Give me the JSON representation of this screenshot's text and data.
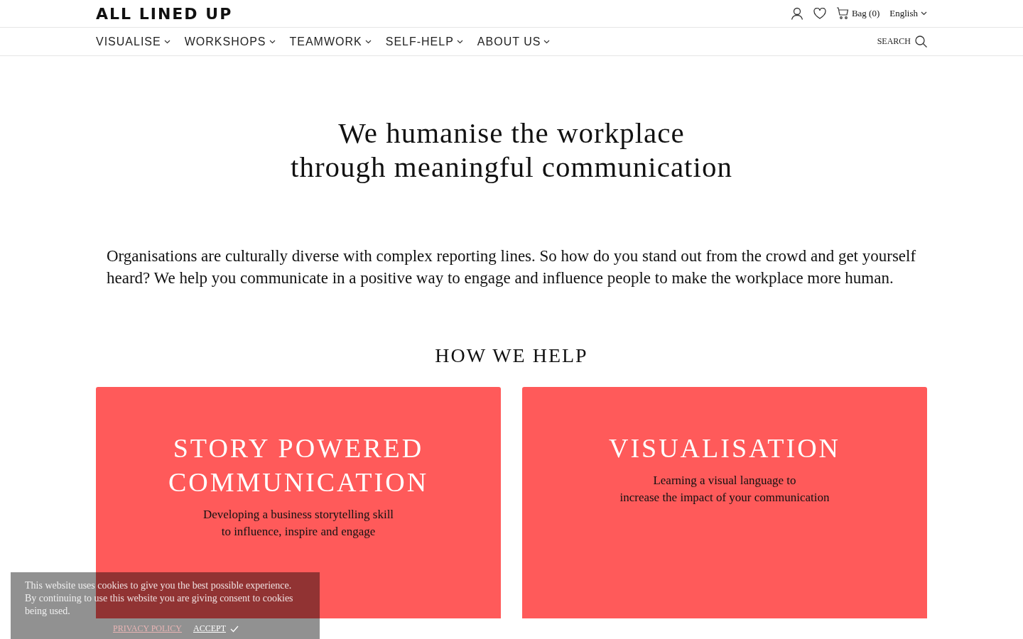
{
  "header": {
    "logo": "ALL LINED UP",
    "bag": "Bag (0)",
    "language": "English"
  },
  "nav": {
    "items": [
      {
        "label": "VISUALISE"
      },
      {
        "label": "WORKSHOPS"
      },
      {
        "label": "TEAMWORK"
      },
      {
        "label": "SELF-HELP"
      },
      {
        "label": "ABOUT US"
      }
    ],
    "search": "SEARCH"
  },
  "hero": {
    "title_lines": [
      "We humanise the workplace",
      "through meaningful communication"
    ],
    "intro": "Organisations are culturally diverse with complex reporting lines. So how do you stand out from the crowd and get yourself heard? We help you communicate in a positive way to engage and influence people to make the workplace more human."
  },
  "section_title": "HOW WE HELP",
  "cards": [
    {
      "title_lines": [
        "STORY POWERED",
        "COMMUNICATION"
      ],
      "text_lines": [
        "Developing a business storytelling skill",
        "to influence, inspire and engage"
      ]
    },
    {
      "title_lines": [
        "VISUALISATION"
      ],
      "text_lines": [
        "Learning a visual language to",
        "increase the impact of your communication"
      ]
    }
  ],
  "cookie_banner": {
    "text": "This website uses cookies to give you the best possible experience. By continuing to use this website you are giving consent to cookies being used.",
    "privacy_link": "PRIVACY POLICY",
    "accept": "ACCEPT"
  }
}
